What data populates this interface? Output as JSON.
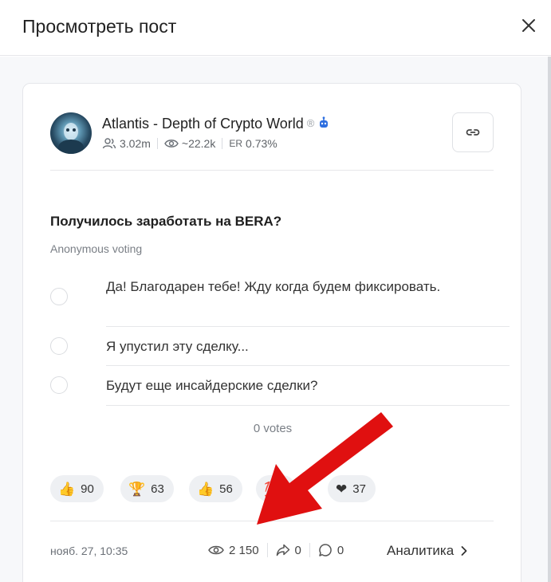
{
  "header": {
    "title": "Просмотреть пост"
  },
  "channel": {
    "name": "Atlantis - Depth of Crypto World",
    "verified_mark": "®",
    "subscribers": "3.02m",
    "avg_views": "~22.2k",
    "er_label": "ER",
    "er_value": "0.73%"
  },
  "poll": {
    "question": "Получилось заработать на BERA?",
    "type": "Anonymous voting",
    "options": [
      "Да! Благодарен тебе! Жду когда будем фиксировать.",
      "Я упустил эту сделку...",
      "Будут еще инсайдерские сделки?"
    ],
    "votes": "0 votes"
  },
  "reactions": [
    {
      "icon": "thumbs-up-rocket-icon",
      "glyph": "👍",
      "count": "90"
    },
    {
      "icon": "trophy-icon",
      "glyph": "🏆",
      "count": "63"
    },
    {
      "icon": "thumbs-up-icon",
      "glyph": "👍",
      "count": "56"
    },
    {
      "icon": "hundred-icon",
      "glyph": "💯",
      "count": ""
    },
    {
      "icon": "heart-icon",
      "glyph": "❤",
      "count": "37"
    }
  ],
  "footer": {
    "date": "нояб. 27, 10:35",
    "views": "2 150",
    "shares": "0",
    "comments": "0",
    "analytics": "Аналитика"
  },
  "colors": {
    "accent_arrow": "#e01010",
    "bot_blue": "#2e6fe0",
    "reaction_bg": "#eef0f3"
  }
}
